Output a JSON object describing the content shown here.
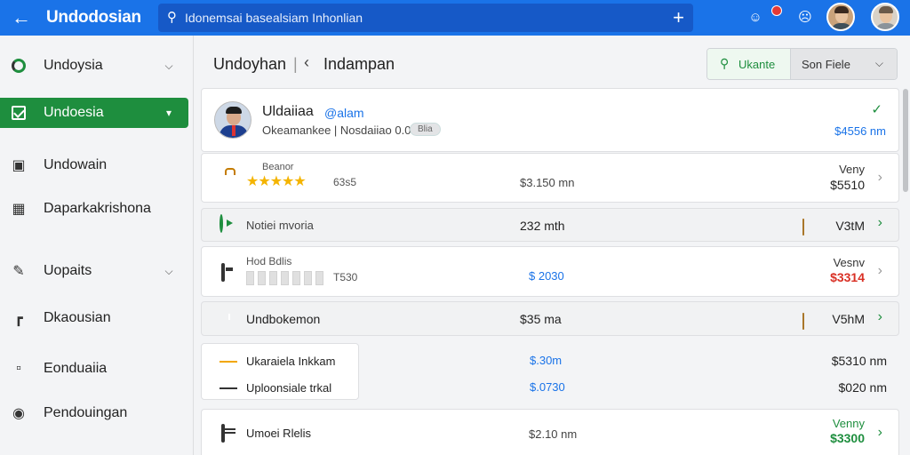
{
  "topbar": {
    "title": "Undodosian",
    "search_text": "Idonemsai basealsiam Inhonlian",
    "back_icon": "arrow-left-icon",
    "plus_icon": "plus-icon",
    "accent": "#1a73e8"
  },
  "sidebar": {
    "items": [
      {
        "label": "Undoysia",
        "icon": "circle-progress-icon"
      },
      {
        "label": "Undoesia",
        "icon": "check-square-icon",
        "active": true
      },
      {
        "label": "Undowain",
        "icon": "camera-icon"
      },
      {
        "label": "Daparkakrishona",
        "icon": "grid-icon"
      },
      {
        "label": "Uopaits",
        "icon": "pencil-icon"
      },
      {
        "label": "Dkaousian",
        "icon": "chart-icon"
      },
      {
        "label": "Eonduaiia",
        "icon": "folder-icon"
      },
      {
        "label": "Pendouingan",
        "icon": "record-icon"
      }
    ],
    "active_color": "#1e8e3e"
  },
  "header": {
    "title": "Undoyhan",
    "separator": "|",
    "subtitle": "Indampan",
    "search_label": "Ukante",
    "sort_label": "Son Fiele"
  },
  "profile": {
    "name": "Uldaiiaa",
    "handle": "@alam",
    "meta": "Okeamankee | Nosdaiiao 0.0",
    "pill": "Blia",
    "amount": "$4556 nm"
  },
  "rows": {
    "rating": {
      "title": "Beanor",
      "rating_value": 5,
      "count": "63s5",
      "mid": "$3.150 mn",
      "right_top": "Veny",
      "right_bottom": "$5510"
    },
    "notiei": {
      "label": "Notiei mvoria",
      "mid": "232 mth",
      "right": "V3tM"
    },
    "hod": {
      "title": "Hod Bdlis",
      "code": "T530",
      "mid": "$ 2030",
      "right_top": "Vesnv",
      "right_bottom": "$3314"
    },
    "undbk": {
      "label": "Undbokemon",
      "mid": "$35 ma",
      "right": "V5hM"
    },
    "group": {
      "item1": {
        "label": "Ukaraiela Inkkam",
        "mid": "$.30m",
        "right": "$5310 nm"
      },
      "item2": {
        "label": "Uploonsiale trkal",
        "mid": "$.0730",
        "right": "$020 nm"
      }
    },
    "umoei": {
      "label": "Umoei Rlelis",
      "mid": "$2.10 nm",
      "right_top": "Venny",
      "right_bottom": "$3300"
    }
  }
}
